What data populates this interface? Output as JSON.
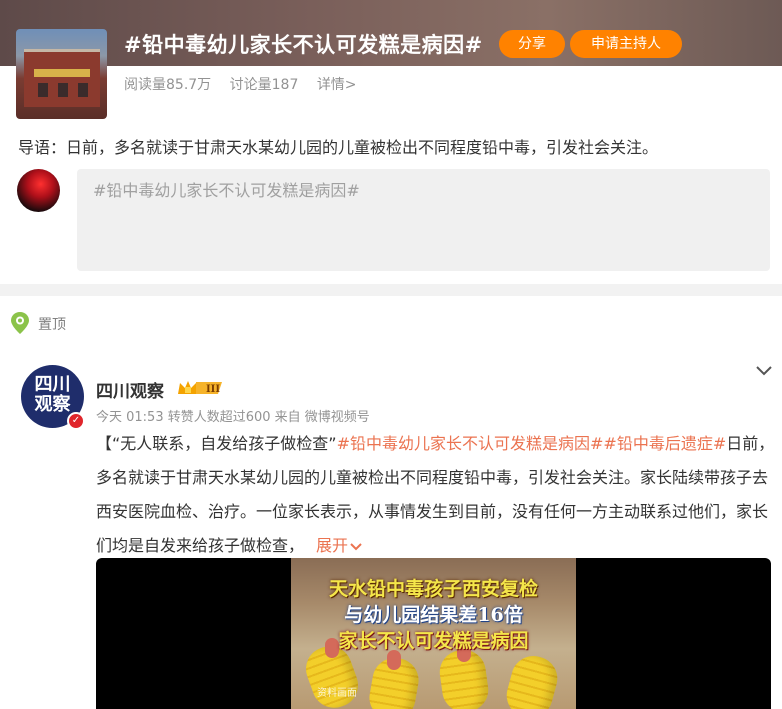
{
  "topic": {
    "title": "#铅中毒幼儿家长不认可发糕是病因#",
    "share_label": "分享",
    "host_label": "申请主持人",
    "reads": "阅读量85.7万",
    "discussions": "讨论量187",
    "details": "详情>",
    "intro": "导语：日前，多名就读于甘肃天水某幼儿园的儿童被检出不同程度铅中毒，引发社会关注。"
  },
  "compose": {
    "placeholder": "#铅中毒幼儿家长不认可发糕是病因#"
  },
  "pinned": {
    "label": "置顶"
  },
  "post": {
    "author": "四川观察",
    "avatar_text_line1": "四川",
    "avatar_text_line2": "观察",
    "vip_level": "III",
    "meta": "今天 01:53 转赞人数超过600   来自 微博视频号",
    "body_start": "【“无人联系，自发给孩子做检查”",
    "tag1": "#铅中毒幼儿家长不认可发糕是病因#",
    "tag2": "#铅中毒后遗症#",
    "body_rest": "日前，多名就读于甘肃天水某幼儿园的儿童被检出不同程度铅中毒，引发社会关注。家长陆续带孩子去西安医院血检、治疗。一位家长表示，从事情发生到目前，没有任何一方主动联系过他们，家长们均是自发来给孩子做检查，",
    "expand_label": "展开",
    "video": {
      "caption1": "天水铅中毒孩子西安复检",
      "caption2": "与幼儿园结果差16倍",
      "caption3": "家长不认可发糕是病因",
      "source": "资料画面"
    }
  },
  "colors": {
    "accent_orange": "#ff8200",
    "tag_orange": "#eb7350",
    "muted_gray": "#939393"
  },
  "icons": [
    "pin-icon",
    "chevron-down-icon",
    "vip-crown-icon",
    "verified-icon",
    "chevron-down-small-icon"
  ]
}
